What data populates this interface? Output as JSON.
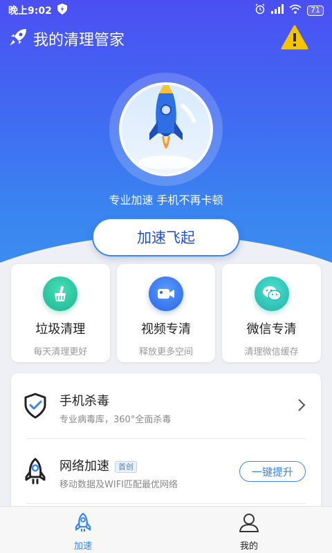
{
  "status_bar": {
    "time": "晚上9:02",
    "battery": "71"
  },
  "header": {
    "title": "我的清理管家"
  },
  "hero": {
    "slogan": "专业加速 手机不再卡顿",
    "boost_button": "加速飞起"
  },
  "feature_cards": [
    {
      "title": "垃圾清理",
      "subtitle": "每天清理更好",
      "icon": "broom-icon",
      "color": "#2cc4a0"
    },
    {
      "title": "视频专清",
      "subtitle": "释放更多空间",
      "icon": "video-camera-icon",
      "color": "#3a7ff0"
    },
    {
      "title": "微信专清",
      "subtitle": "清理微信缓存",
      "icon": "wechat-icon",
      "color": "#2cc4b8"
    }
  ],
  "tools": [
    {
      "title": "手机杀毒",
      "subtitle": "专业病毒库，360°全面杀毒",
      "icon": "shield-check-icon"
    },
    {
      "title": "网络加速",
      "badge": "首创",
      "subtitle": "移动数据及WIFI匹配最优网络",
      "icon": "rocket-outline-icon",
      "action": "一键提升"
    }
  ],
  "tabbar": {
    "tabs": [
      {
        "label": "加速",
        "icon": "rocket-tab-icon",
        "active": true
      },
      {
        "label": "我的",
        "icon": "user-tab-icon",
        "active": false
      }
    ]
  },
  "colors": {
    "brand": "#3a86f0",
    "hero_top": "#4b4ff2",
    "warning": "#f5c400"
  }
}
